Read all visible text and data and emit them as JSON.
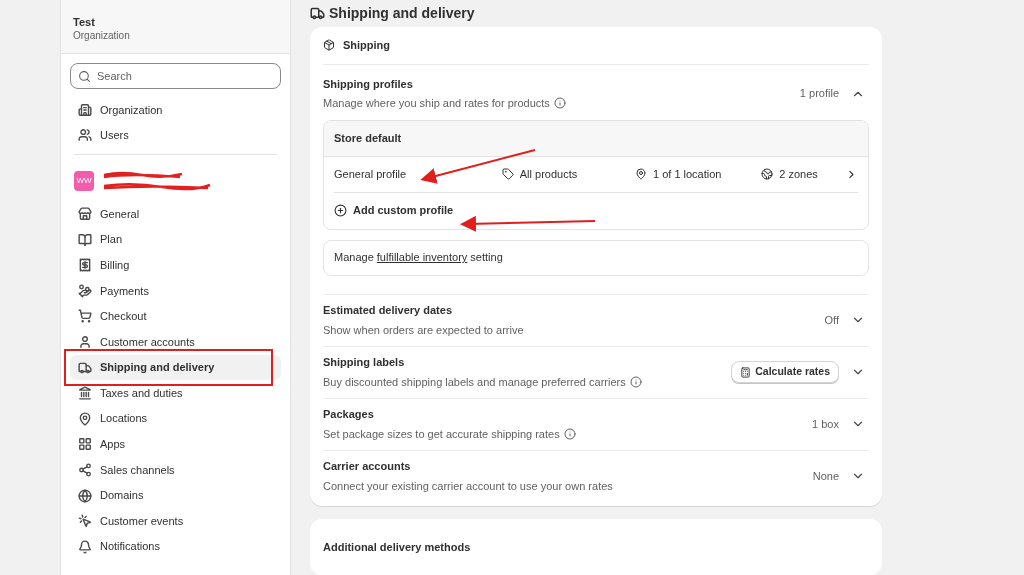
{
  "org": {
    "name": "Test",
    "subtitle": "Organization"
  },
  "search": {
    "placeholder": "Search"
  },
  "org_nav": [
    {
      "label": "Organization",
      "selected": false
    },
    {
      "label": "Users",
      "selected": false
    }
  ],
  "store": {
    "badge": "WW"
  },
  "store_nav": [
    {
      "label": "General",
      "selected": false
    },
    {
      "label": "Plan",
      "selected": false
    },
    {
      "label": "Billing",
      "selected": false
    },
    {
      "label": "Payments",
      "selected": false
    },
    {
      "label": "Checkout",
      "selected": false
    },
    {
      "label": "Customer accounts",
      "selected": false
    },
    {
      "label": "Shipping and delivery",
      "selected": true
    },
    {
      "label": "Taxes and duties",
      "selected": false
    },
    {
      "label": "Locations",
      "selected": false
    },
    {
      "label": "Apps",
      "selected": false
    },
    {
      "label": "Sales channels",
      "selected": false
    },
    {
      "label": "Domains",
      "selected": false
    },
    {
      "label": "Customer events",
      "selected": false
    },
    {
      "label": "Notifications",
      "selected": false
    }
  ],
  "page_title": "Shipping and delivery",
  "shipping_card": {
    "title": "Shipping",
    "profiles": {
      "title": "Shipping profiles",
      "description": "Manage where you ship and rates for products",
      "value": "1 profile",
      "expanded": true,
      "group_title": "Store default",
      "profile": {
        "name": "General profile",
        "products": "All products",
        "locations": "1 of 1 location",
        "zones": "2 zones"
      },
      "add_label": "Add custom profile"
    },
    "inventory_link": "fulfillable inventory",
    "inventory_before": "Manage ",
    "inventory_after": " setting",
    "sections": [
      {
        "title": "Estimated delivery dates",
        "description": "Show when orders are expected to arrive",
        "value": "Off",
        "kind": "value",
        "info": false,
        "expanded": false
      },
      {
        "title": "Shipping labels",
        "description": "Buy discounted shipping labels and manage preferred carriers",
        "value": "Calculate rates",
        "kind": "button",
        "info": true,
        "expanded": false
      },
      {
        "title": "Packages",
        "description": "Set package sizes to get accurate shipping rates",
        "value": "1 box",
        "kind": "value",
        "info": true,
        "expanded": false
      },
      {
        "title": "Carrier accounts",
        "description": "Connect your existing carrier account to use your own rates",
        "value": "None",
        "kind": "value",
        "info": false,
        "expanded": false
      }
    ]
  },
  "additional_card": {
    "title": "Additional delivery methods"
  }
}
